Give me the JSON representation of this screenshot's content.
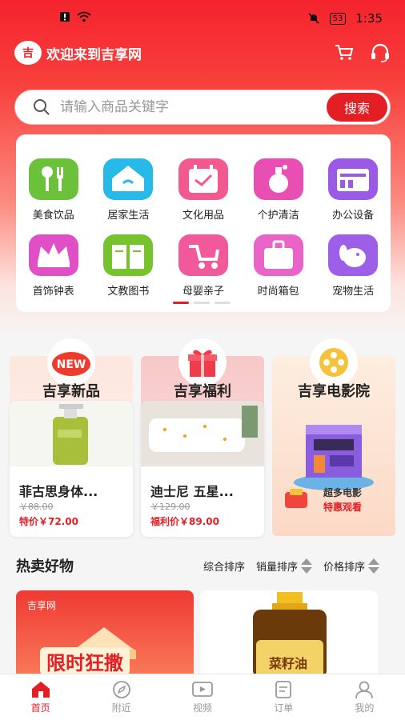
{
  "status_bar": {
    "battery": "53",
    "time": "1:35"
  },
  "header": {
    "logo_text": "吉",
    "title": "欢迎来到吉享网"
  },
  "search": {
    "placeholder": "请输入商品关键字",
    "button_label": "搜索"
  },
  "categories": [
    {
      "label": "美食饮品",
      "icon": "utensils-icon",
      "color": "#6bc23a"
    },
    {
      "label": "居家生活",
      "icon": "home-icon",
      "color": "#27b9e8"
    },
    {
      "label": "文化用品",
      "icon": "calendar-icon",
      "color": "#f25a8f"
    },
    {
      "label": "个护清洁",
      "icon": "perfume-icon",
      "color": "#e94fb3"
    },
    {
      "label": "办公设备",
      "icon": "office-icon",
      "color": "#9a5ae6"
    },
    {
      "label": "首饰钟表",
      "icon": "crown-icon",
      "color": "#e04fc6"
    },
    {
      "label": "文教图书",
      "icon": "book-icon",
      "color": "#77c32e"
    },
    {
      "label": "母婴亲子",
      "icon": "stroller-icon",
      "color": "#f2599a"
    },
    {
      "label": "时尚箱包",
      "icon": "suitcase-icon",
      "color": "#ea63c6"
    },
    {
      "label": "宠物生活",
      "icon": "dog-icon",
      "color": "#9d5fe8"
    }
  ],
  "promos": [
    {
      "title": "吉享新品",
      "name": "菲古思身体...",
      "old_price": "￥88.00",
      "new_price": "特价￥72.00",
      "badge": "NEW"
    },
    {
      "title": "吉享福利",
      "name": "迪士尼 五星...",
      "old_price": "￥129.00",
      "new_price": "福利价￥89.00"
    },
    {
      "title": "吉享电影院",
      "caption1": "超多电影",
      "caption2": "特惠观看"
    }
  ],
  "hot": {
    "title": "热卖好物",
    "sorts": [
      "综合排序",
      "销量排序",
      "价格排序"
    ]
  },
  "products": [
    {
      "brand": "吉享网",
      "banner": "限时狂撒"
    },
    {
      "label": "菜籽油"
    }
  ],
  "tabs": [
    {
      "label": "首页",
      "icon": "home-tab-icon",
      "active": true
    },
    {
      "label": "附近",
      "icon": "compass-icon",
      "active": false
    },
    {
      "label": "视频",
      "icon": "video-icon",
      "active": false
    },
    {
      "label": "订单",
      "icon": "order-icon",
      "active": false
    },
    {
      "label": "我的",
      "icon": "user-icon",
      "active": false
    }
  ]
}
